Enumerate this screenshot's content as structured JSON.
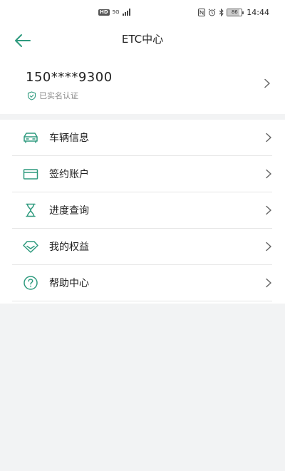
{
  "status_bar": {
    "hd_badge": "HD",
    "network": "5G",
    "nfc_icon": "nfc-icon",
    "alarm_icon": "alarm-icon",
    "bluetooth_icon": "bluetooth-icon",
    "battery_level": "86",
    "time": "14:44"
  },
  "nav": {
    "title": "ETC中心",
    "back_icon": "back-arrow-icon"
  },
  "account": {
    "phone": "150****9300",
    "verified_label": "已实名认证"
  },
  "menu": {
    "items": [
      {
        "label": "车辆信息",
        "icon": "car-icon"
      },
      {
        "label": "签约账户",
        "icon": "card-icon"
      },
      {
        "label": "进度查询",
        "icon": "hourglass-icon"
      },
      {
        "label": "我的权益",
        "icon": "diamond-icon"
      },
      {
        "label": "帮助中心",
        "icon": "help-icon"
      }
    ]
  },
  "colors": {
    "accent": "#2e9a7e",
    "background": "#f2f3f4",
    "card": "#ffffff",
    "divider": "#e6e6e6"
  }
}
